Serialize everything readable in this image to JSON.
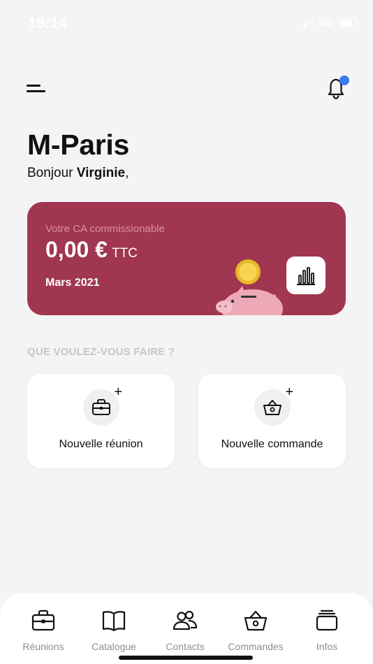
{
  "status_bar": {
    "time": "15:14",
    "network": "4G"
  },
  "header": {
    "menu_icon": "menu-icon",
    "notification_icon": "bell-icon",
    "notification_badge_color": "#3a7af2"
  },
  "brand": {
    "title": "M-Paris",
    "greeting_prefix": "Bonjour ",
    "user_name": "Virginie",
    "greeting_suffix": ","
  },
  "ca_card": {
    "label": "Votre CA commissionable",
    "amount": "0,00 €",
    "unit": "TTC",
    "period": "Mars 2021",
    "background_color": "#a03650",
    "stats_icon": "bar-chart-icon",
    "illustration": "piggy-bank-coin-icon"
  },
  "actions": {
    "section_title": "QUE VOULEZ-VOUS FAIRE ?",
    "items": [
      {
        "label": "Nouvelle réunion",
        "icon": "briefcase-plus-icon"
      },
      {
        "label": "Nouvelle commande",
        "icon": "basket-plus-icon"
      }
    ]
  },
  "tab_bar": {
    "items": [
      {
        "label": "Réunions",
        "icon": "briefcase-icon"
      },
      {
        "label": "Catalogue",
        "icon": "book-icon"
      },
      {
        "label": "Contacts",
        "icon": "users-icon"
      },
      {
        "label": "Commandes",
        "icon": "basket-icon"
      },
      {
        "label": "Infos",
        "icon": "stack-icon"
      }
    ]
  }
}
